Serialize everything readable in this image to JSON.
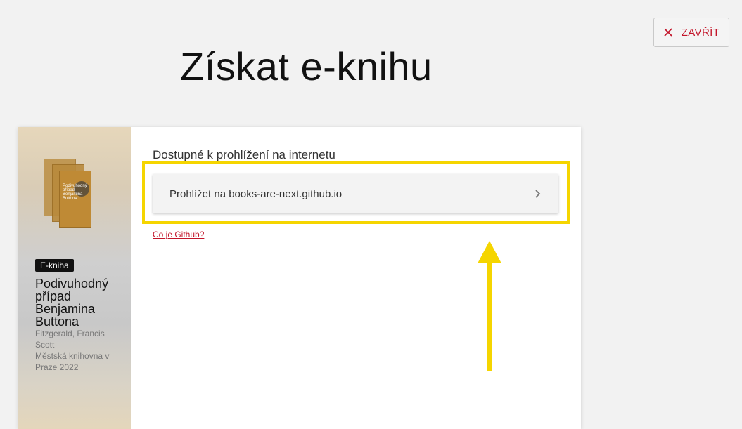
{
  "header": {
    "close_label": "ZAVŘÍT",
    "page_title": "Získat e-knihu"
  },
  "book": {
    "badge": "E-kniha",
    "title": "Podivuhodný případ Benjamina Buttona",
    "author": "Fitzgerald, Francis Scott",
    "publisher": "Městská knihovna v Praze 2022",
    "cover_text": "Podivuhodný případ Benjamina Buttona"
  },
  "access": {
    "heading": "Dostupné k prohlížení na internetu",
    "browse_label": "Prohlížet na books-are-next.github.io",
    "help_link": "Co je Github?"
  },
  "annotation": {
    "highlight_color": "#f5d500"
  },
  "colors": {
    "accent": "#c3152a",
    "background": "#f2f2f2"
  }
}
